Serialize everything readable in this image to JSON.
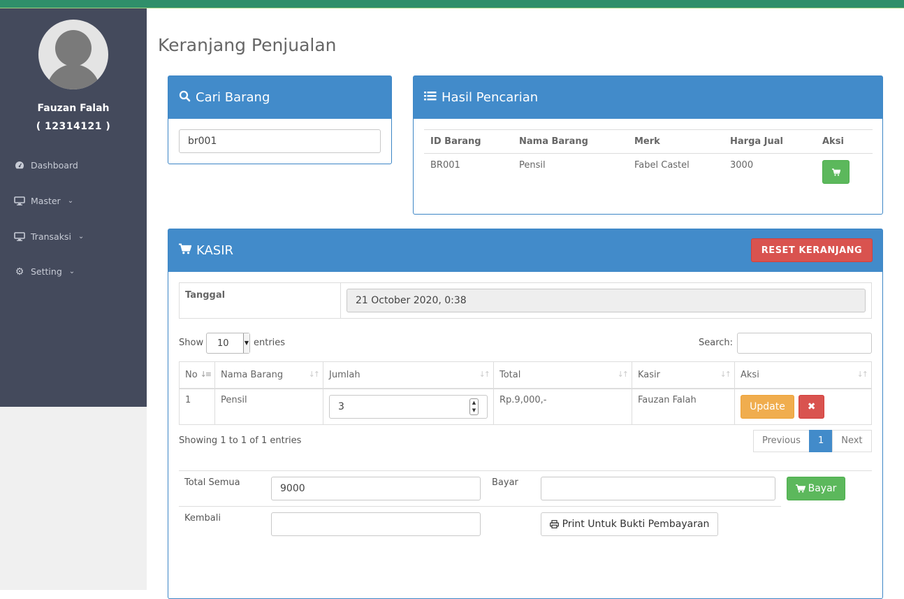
{
  "sidebar": {
    "user_name": "Fauzan Falah",
    "user_id": "( 12314121 )",
    "items": [
      {
        "label": "Dashboard",
        "icon": "dashboard-icon",
        "has_caret": false
      },
      {
        "label": "Master",
        "icon": "desktop-icon",
        "has_caret": true
      },
      {
        "label": "Transaksi",
        "icon": "desktop-icon",
        "has_caret": true
      },
      {
        "label": "Setting",
        "icon": "gear-icon",
        "has_caret": true
      }
    ]
  },
  "page_title": "Keranjang Penjualan",
  "search_panel": {
    "title": "Cari Barang",
    "input_value": "br001"
  },
  "results_panel": {
    "title": "Hasil Pencarian",
    "columns": [
      "ID Barang",
      "Nama Barang",
      "Merk",
      "Harga Jual",
      "Aksi"
    ],
    "rows": [
      {
        "id": "BR001",
        "nama": "Pensil",
        "merk": "Fabel Castel",
        "harga": "3000"
      }
    ]
  },
  "kasir": {
    "title": "KASIR",
    "reset_label": "RESET KERANJANG",
    "tanggal_label": "Tanggal",
    "tanggal_value": "21 October 2020, 0:38",
    "show_label": "Show",
    "entries_value": "10",
    "entries_label": "entries",
    "search_label": "Search:",
    "columns": [
      "No",
      "Nama Barang",
      "Jumlah",
      "Total",
      "Kasir",
      "Aksi"
    ],
    "rows": [
      {
        "no": "1",
        "nama": "Pensil",
        "jumlah": "3",
        "total": "Rp.9,000,-",
        "kasir": "Fauzan Falah"
      }
    ],
    "update_label": "Update",
    "showing_text": "Showing 1 to 1 of 1 entries",
    "pager": {
      "previous": "Previous",
      "current": "1",
      "next": "Next"
    },
    "total_semua_label": "Total Semua",
    "total_semua_value": "9000",
    "bayar_label": "Bayar",
    "bayar_value": "",
    "bayar_button": "Bayar",
    "kembali_label": "Kembali",
    "kembali_value": "",
    "print_button": "Print Untuk Bukti Pembayaran"
  },
  "colors": {
    "topbar": "#2f8f6a",
    "sidebar": "#444a5c",
    "panel_header": "#428bca",
    "success": "#5cb85c",
    "danger": "#d9534f",
    "warning": "#f0ad4e"
  }
}
